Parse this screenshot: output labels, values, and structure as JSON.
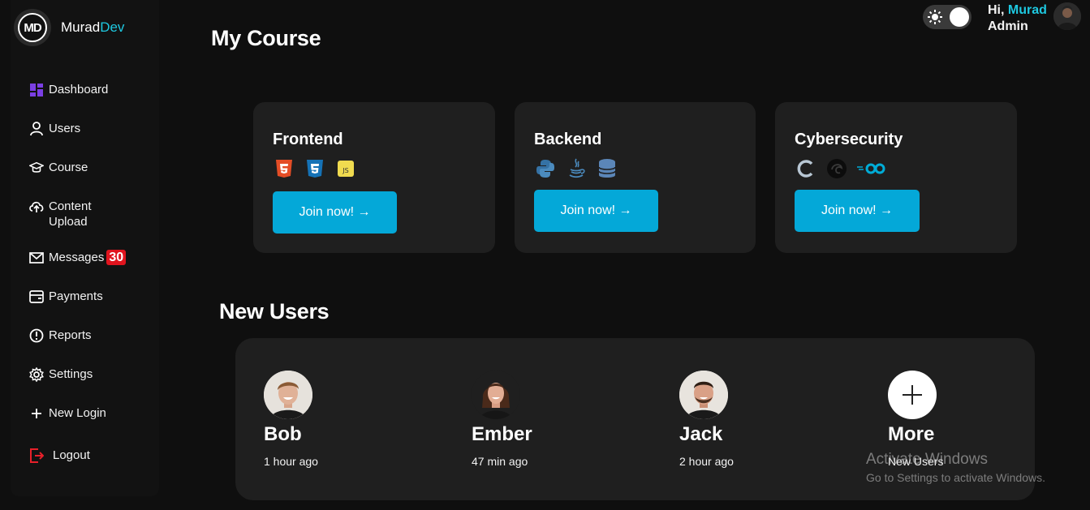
{
  "brand": {
    "prefix": "Murad",
    "accent": "Dev",
    "badge": "MD"
  },
  "header": {
    "greeting": "Hi,",
    "user_name": "Murad",
    "role": "Admin"
  },
  "sidebar": {
    "items": [
      {
        "label": "Dashboard",
        "icon": "dashboard-icon"
      },
      {
        "label": "Users",
        "icon": "user-icon"
      },
      {
        "label": "Course",
        "icon": "graduation-cap-icon"
      },
      {
        "label": "Content Upload",
        "icon": "cloud-upload-icon"
      },
      {
        "label": "Messages",
        "icon": "mail-icon",
        "badge": "30"
      },
      {
        "label": "Payments",
        "icon": "wallet-icon"
      },
      {
        "label": "Reports",
        "icon": "alert-circle-icon"
      },
      {
        "label": "Settings",
        "icon": "gear-icon"
      },
      {
        "label": "New Login",
        "icon": "plus-icon"
      },
      {
        "label": "Logout",
        "icon": "logout-icon"
      }
    ]
  },
  "courses": {
    "title": "My Course",
    "cards": [
      {
        "name": "Frontend",
        "icons": [
          "html5-icon",
          "css3-icon",
          "javascript-icon"
        ],
        "button": "Join now! →"
      },
      {
        "name": "Backend",
        "icons": [
          "python-icon",
          "java-icon",
          "database-icon"
        ],
        "button": "Join now! →"
      },
      {
        "name": "Cybersecurity",
        "icons": [
          "c-language-icon",
          "kali-icon",
          "go-icon"
        ],
        "button": "Join now! →"
      }
    ]
  },
  "new_users": {
    "title": "New Users",
    "users": [
      {
        "name": "Bob",
        "time": "1 hour ago"
      },
      {
        "name": "Ember",
        "time": "47 min ago"
      },
      {
        "name": "Jack",
        "time": "2 hour ago"
      }
    ],
    "more": {
      "name": "More",
      "subtitle": "New Users"
    }
  },
  "watermark": {
    "line1": "Activate Windows",
    "line2": "Go to Settings to activate Windows."
  },
  "colors": {
    "accent": "#1ec8e0",
    "button": "#04a8d8",
    "badge": "#e0141e",
    "card": "#1f1f1f",
    "background": "#0f0f0f"
  }
}
